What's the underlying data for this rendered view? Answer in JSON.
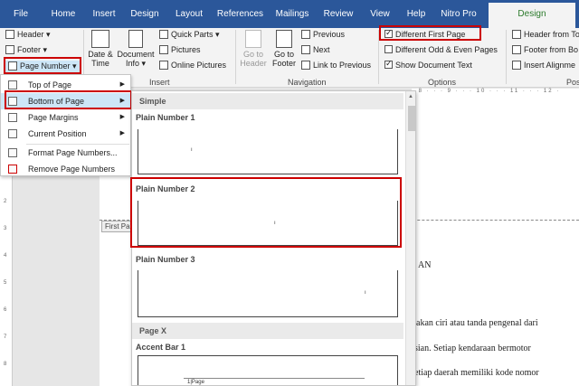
{
  "tabs": {
    "file": "File",
    "items": [
      "Home",
      "Insert",
      "Design",
      "Layout",
      "References",
      "Mailings",
      "Review",
      "View",
      "Help",
      "Nitro Pro"
    ],
    "active": "Design"
  },
  "ribbon": {
    "header": "Header",
    "footer": "Footer",
    "page_number": "Page Number",
    "date_time": [
      "Date &",
      "Time"
    ],
    "doc_info": [
      "Document",
      "Info"
    ],
    "quick_parts": "Quick Parts",
    "pictures": "Pictures",
    "online_pictures": "Online Pictures",
    "go_header": [
      "Go to",
      "Header"
    ],
    "go_footer": [
      "Go to",
      "Footer"
    ],
    "previous": "Previous",
    "next": "Next",
    "link_previous": "Link to Previous",
    "diff_first": "Different First Page",
    "diff_odd_even": "Different Odd & Even Pages",
    "show_doc_text": "Show Document Text",
    "header_from": "Header from To",
    "footer_from": "Footer from Bo",
    "insert_align": "Insert Alignme",
    "groups": {
      "insert": "Insert",
      "navigation": "Navigation",
      "options": "Options",
      "pos": "Pos"
    }
  },
  "menu": {
    "items": [
      "Top of Page",
      "Bottom of Page",
      "Page Margins",
      "Current Position",
      "Format Page Numbers...",
      "Remove Page Numbers"
    ]
  },
  "gallery": {
    "sections": [
      "Simple",
      "Page X"
    ],
    "items": [
      "Plain Number 1",
      "Plain Number 2",
      "Plain Number 3",
      "Accent Bar 1"
    ],
    "number_glyph": "ı",
    "accent_text": "1|Page"
  },
  "document": {
    "first_page_tag": "First Pa",
    "heading_frag": "AN",
    "lines": [
      "pakan ciri atau tanda pengenal dari",
      "sian. Setiap kendaraan bermotor",
      "etiap daerah memiliki kode nomor"
    ],
    "ruler_top": "· 8 · · · 9 · · · 10 · · · 11 · · · 12 ·",
    "ruler_left": [
      "1",
      "2",
      "3",
      "4",
      "5",
      "6",
      "7",
      "8",
      "9"
    ]
  }
}
